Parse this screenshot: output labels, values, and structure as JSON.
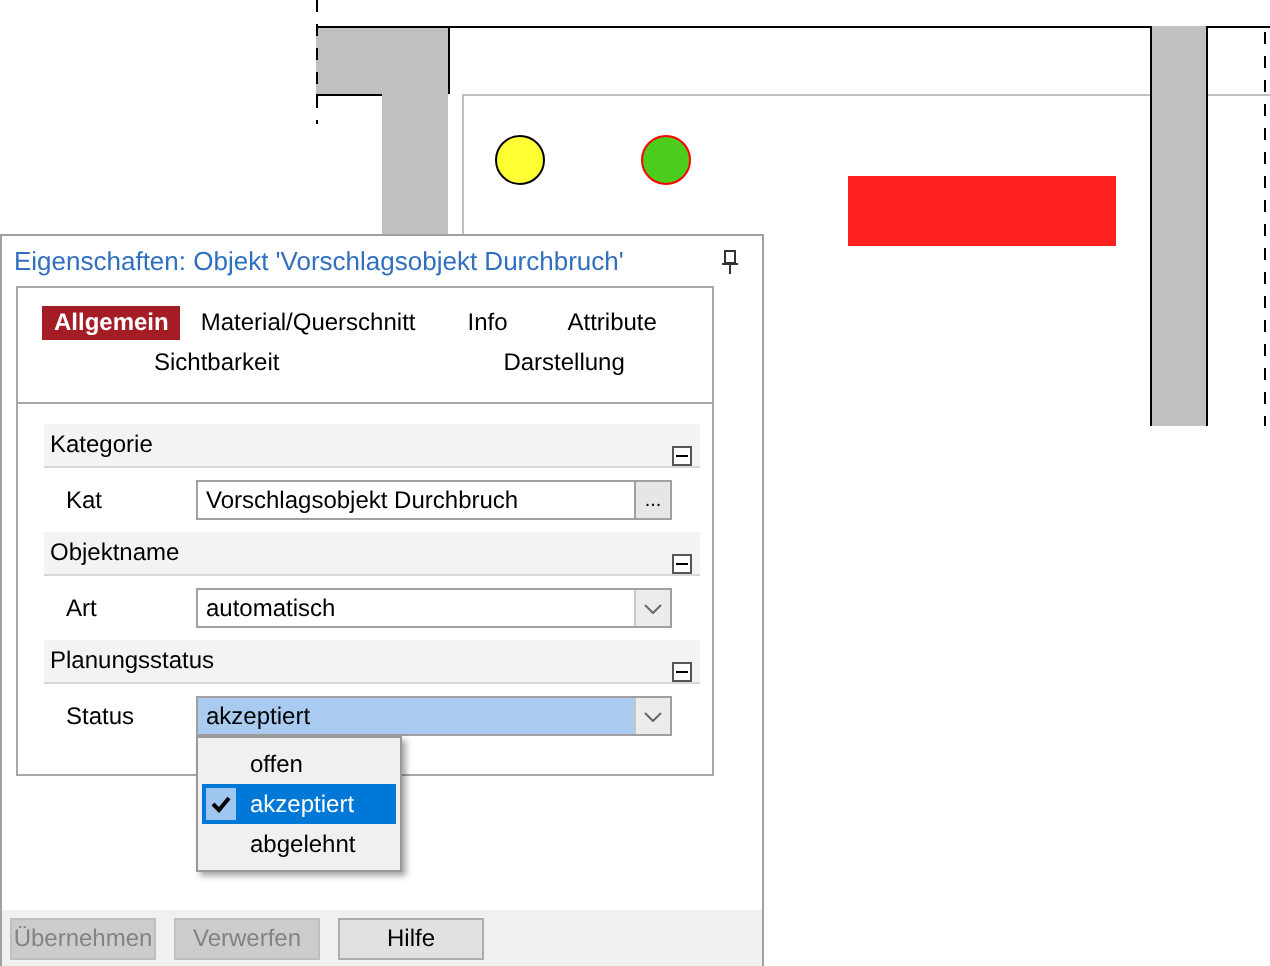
{
  "drawing": {
    "markers": [
      {
        "kind": "dot",
        "color": "#ffff33"
      },
      {
        "kind": "dot",
        "color": "#4ccc1c"
      },
      {
        "kind": "bar",
        "color": "#ff2020"
      }
    ]
  },
  "panel": {
    "title": "Eigenschaften: Objekt 'Vorschlagsobjekt Durchbruch'",
    "tab_rows": [
      [
        {
          "label": "Allgemein",
          "selected": true
        },
        {
          "label": "Material/Querschnitt",
          "selected": false
        },
        {
          "label": "Info",
          "selected": false
        },
        {
          "label": "Attribute",
          "selected": false
        }
      ],
      [
        {
          "label": "Sichtbarkeit",
          "selected": false
        },
        {
          "label": "Darstellung",
          "selected": false
        }
      ]
    ],
    "sections": [
      {
        "title": "Kategorie",
        "expanded": true,
        "rows": [
          {
            "label": "Kat",
            "kind": "browse",
            "value": "Vorschlagsobjekt Durchbruch",
            "button": "..."
          }
        ]
      },
      {
        "title": "Objektname",
        "expanded": true,
        "rows": [
          {
            "label": "Art",
            "kind": "combo",
            "value": "automatisch"
          }
        ]
      },
      {
        "title": "Planungsstatus",
        "expanded": true,
        "rows": [
          {
            "label": "Status",
            "kind": "combo",
            "value": "akzeptiert",
            "open": true
          }
        ]
      }
    ],
    "dropdown": {
      "options": [
        {
          "label": "offen",
          "selected": false
        },
        {
          "label": "akzeptiert",
          "selected": true
        },
        {
          "label": "abgelehnt",
          "selected": false
        }
      ]
    },
    "buttons": [
      {
        "label": "Übernehmen",
        "disabled": true
      },
      {
        "label": "Verwerfen",
        "disabled": true
      },
      {
        "label": "Hilfe",
        "disabled": false
      }
    ]
  }
}
